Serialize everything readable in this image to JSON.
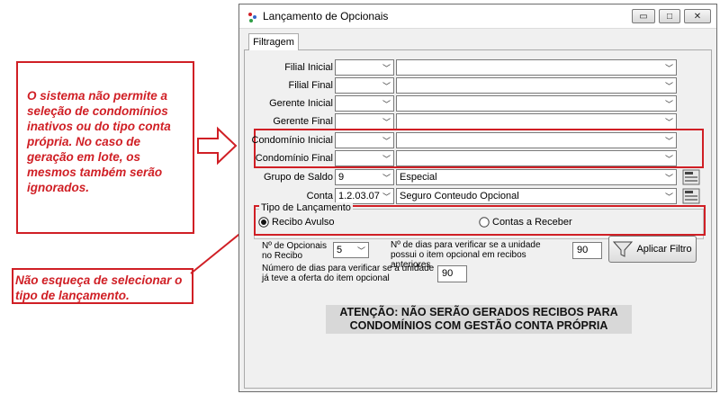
{
  "annotations": {
    "main_note": "O sistema não permite a seleção de condomínios inativos ou do tipo conta própria. No caso de geração em lote, os mesmos também serão ignorados.",
    "type_note": "Não esqueça de selecionar o tipo de lançamento."
  },
  "window": {
    "title": "Lançamento de Opcionais",
    "controls": {
      "minimize": "▭",
      "maximize": "□",
      "close": "✕"
    }
  },
  "tabs": [
    "Filtragem"
  ],
  "filters": [
    {
      "label": "Filial Inicial",
      "code": "",
      "value": ""
    },
    {
      "label": "Filial Final",
      "code": "",
      "value": ""
    },
    {
      "label": "Gerente Inicial",
      "code": "",
      "value": ""
    },
    {
      "label": "Gerente Final",
      "code": "",
      "value": ""
    },
    {
      "label": "Condomínio Inicial",
      "code": "",
      "value": ""
    },
    {
      "label": "Condomínio Final",
      "code": "",
      "value": ""
    },
    {
      "label": "Grupo de Saldo",
      "code": "9",
      "value": "Especial"
    },
    {
      "label": "Conta",
      "code": "1.2.03.07",
      "value": "Seguro Conteudo Opcional"
    }
  ],
  "tipo_lancamento": {
    "legend": "Tipo de Lançamento",
    "options": [
      {
        "label": "Recibo Avulso",
        "selected": true
      },
      {
        "label": "Contas a Receber",
        "selected": false
      }
    ]
  },
  "opcionais": {
    "label": "Nº de Opcionais no Recibo",
    "value": "5"
  },
  "dias_recibos": {
    "label": "Nº de dias para verificar se a unidade possui o item opcional em recibos anteriores",
    "value": "90"
  },
  "dias_oferta": {
    "label": "Número de dias para verificar se a unidade já teve a oferta do item opcional",
    "value": "90"
  },
  "apply_button": "Aplicar Filtro",
  "warning": "ATENÇÃO: NÃO SERÃO GERADOS RECIBOS PARA CONDOMÍNIOS COM GESTÃO CONTA PRÓPRIA",
  "colors": {
    "annotation_red": "#d01f25",
    "window_bg": "#f0f0f0"
  }
}
